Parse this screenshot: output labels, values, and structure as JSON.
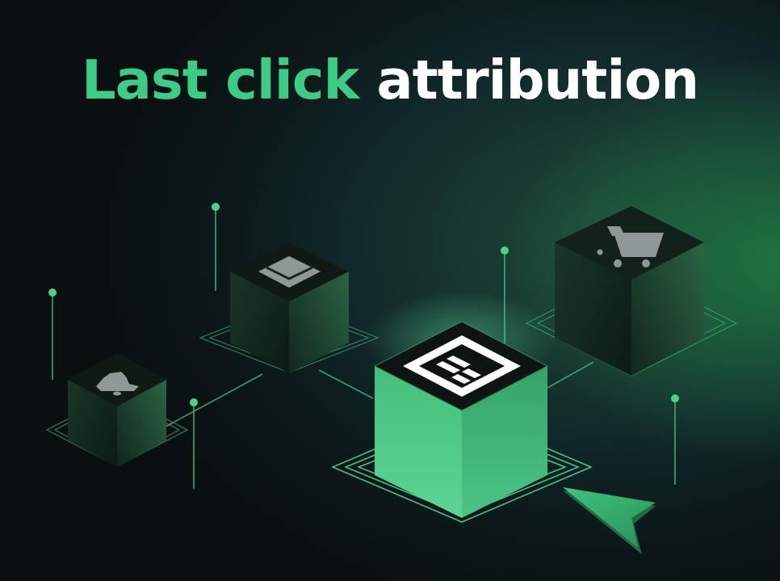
{
  "title": {
    "highlight": "Last click",
    "rest": "attribution"
  },
  "icons": [
    "bell-icon",
    "envelope-icon",
    "browser-window-icon",
    "shopping-cart-icon",
    "cursor-arrow-icon"
  ],
  "colors": {
    "background": "#0a0f10",
    "accent_green": "#3dcc86",
    "bright_cube": "#47c785",
    "dark_cube": "#16271f",
    "line": "#4fcf8f",
    "icon_gray": "#9aa2a0"
  }
}
